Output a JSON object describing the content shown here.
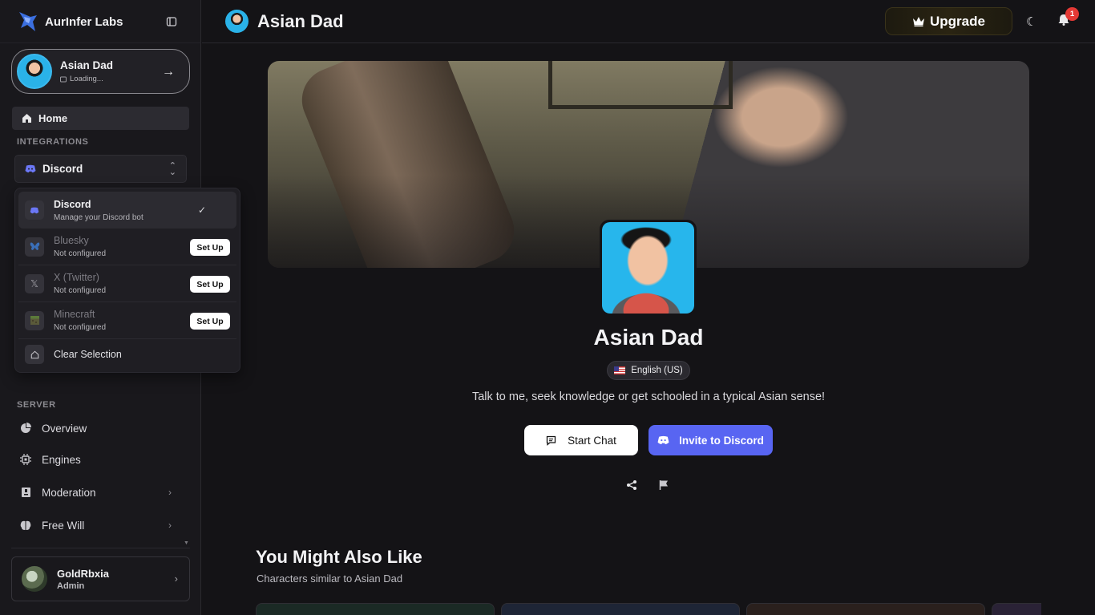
{
  "app": {
    "brand": "AurInfer Labs"
  },
  "character_card": {
    "name": "Asian Dad",
    "status": "Loading..."
  },
  "nav": {
    "home": "Home",
    "integrations_label": "INTEGRATIONS",
    "server_label": "SERVER",
    "server_items": [
      {
        "label": "Overview",
        "icon": "pie-chart-icon"
      },
      {
        "label": "Engines",
        "icon": "chip-icon"
      },
      {
        "label": "Moderation",
        "icon": "gavel-icon"
      },
      {
        "label": "Free Will",
        "icon": "brain-icon"
      }
    ]
  },
  "integration_select": {
    "selected": "Discord",
    "options": [
      {
        "title": "Discord",
        "subtitle": "Manage your Discord bot",
        "selected": true
      },
      {
        "title": "Bluesky",
        "subtitle": "Not configured",
        "action": "Set Up"
      },
      {
        "title": "X (Twitter)",
        "subtitle": "Not configured",
        "action": "Set Up"
      },
      {
        "title": "Minecraft",
        "subtitle": "Not configured",
        "action": "Set Up"
      }
    ],
    "clear": "Clear Selection"
  },
  "user": {
    "name": "GoldRbxia",
    "role": "Admin"
  },
  "header": {
    "title": "Asian Dad",
    "upgrade": "Upgrade",
    "notification_count": "1"
  },
  "profile": {
    "name": "Asian Dad",
    "language": "English (US)",
    "tagline": "Talk to me, seek knowledge or get schooled in a typical Asian sense!",
    "start_chat": "Start Chat",
    "invite": "Invite to Discord"
  },
  "similar": {
    "title": "You Might Also Like",
    "subtitle": "Characters similar to Asian Dad"
  },
  "colors": {
    "accent": "#5865f2",
    "badge": "#e53935"
  }
}
